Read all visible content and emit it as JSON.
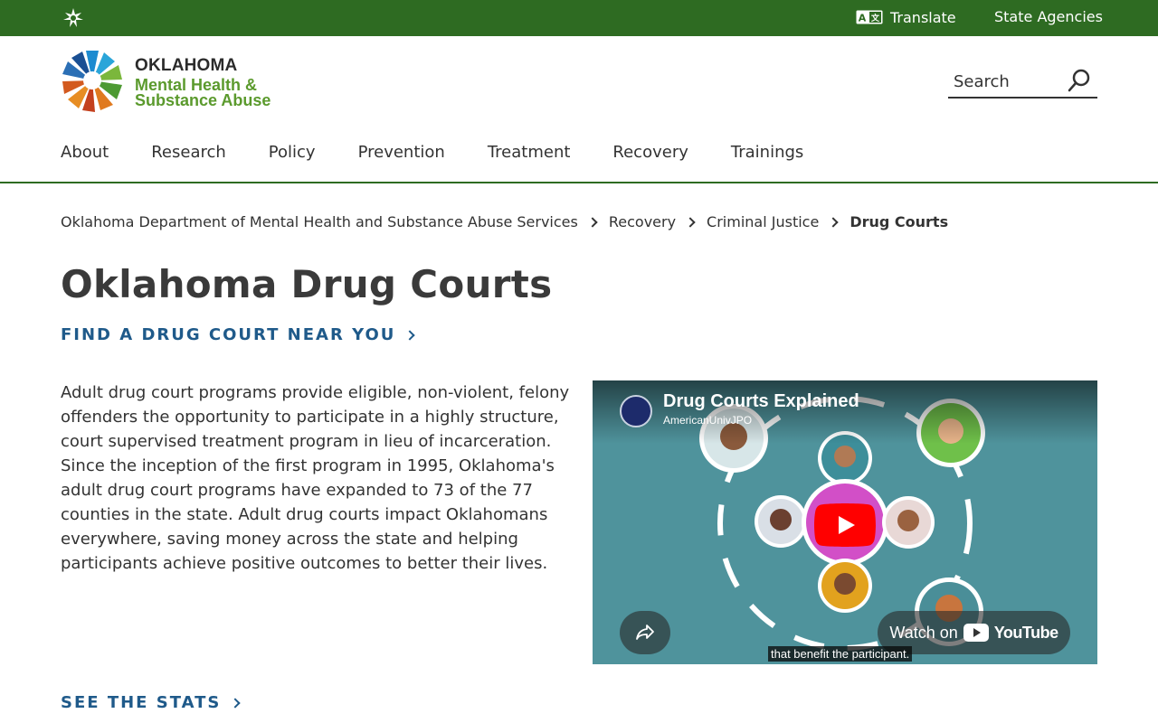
{
  "topbar": {
    "translate_label": "Translate",
    "agencies_label": "State Agencies",
    "translate_icon": "translate-icon",
    "logo_icon": "oklahoma-star-icon"
  },
  "logo": {
    "line1": "OKLAHOMA",
    "line2": "Mental Health &",
    "line3": "Substance Abuse"
  },
  "search": {
    "placeholder": "Search",
    "icon": "search-icon"
  },
  "nav": {
    "items": [
      {
        "label": "About"
      },
      {
        "label": "Research"
      },
      {
        "label": "Policy"
      },
      {
        "label": "Prevention"
      },
      {
        "label": "Treatment"
      },
      {
        "label": "Recovery"
      },
      {
        "label": "Trainings"
      }
    ]
  },
  "breadcrumb": {
    "items": [
      "Oklahoma Department of Mental Health and Substance Abuse Services",
      "Recovery",
      "Criminal Justice"
    ],
    "current": "Drug Courts"
  },
  "page": {
    "title": "Oklahoma Drug Courts",
    "find_link": "FIND A DRUG COURT NEAR YOU",
    "body": "Adult drug court programs provide eligible, non-violent, felony offenders the opportunity to participate in a highly structure, court supervised treatment program in lieu of incarceration. Since the inception of the first program in 1995, Oklahoma's adult drug court programs have expanded to 73 of the 77 counties in the state. Adult drug courts impact Oklahomans everywhere, saving money across the state and helping participants achieve positive outcomes to better their lives.",
    "stats_link": "SEE THE STATS"
  },
  "video": {
    "title": "Drug Courts Explained",
    "channel": "AmericanUnivJPO",
    "watch_on": "Watch on",
    "youtube": "YouTube",
    "caption": "that benefit the participant.",
    "play_icon": "play-icon",
    "share_icon": "share-icon",
    "youtube_icon": "youtube-icon"
  },
  "colors": {
    "brand_green": "#2e6b22",
    "link_blue": "#1f5a8a",
    "logo_green": "#5b9a2d",
    "youtube_red": "#ff0000"
  }
}
